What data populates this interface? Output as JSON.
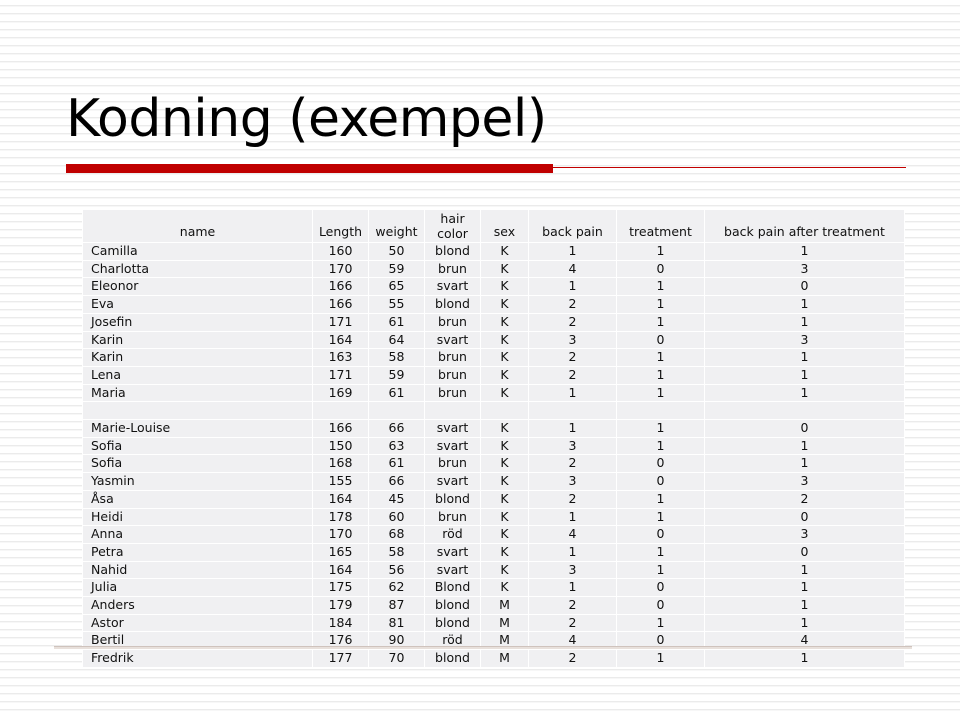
{
  "slide": {
    "title": "Kodning (exempel)",
    "accent_color": "#c00000",
    "rule_color": "#cfc3bd"
  },
  "table": {
    "columns": [
      {
        "key": "name",
        "label": "name",
        "line1": "",
        "line2": "name"
      },
      {
        "key": "length",
        "label": "Length",
        "line1": "",
        "line2": "Length"
      },
      {
        "key": "weight",
        "label": "weight",
        "line1": "",
        "line2": "weight"
      },
      {
        "key": "hair_color",
        "label": "hair color",
        "line1": "hair",
        "line2": "color"
      },
      {
        "key": "sex",
        "label": "sex",
        "line1": "",
        "line2": "sex"
      },
      {
        "key": "back_pain",
        "label": "back pain",
        "line1": "",
        "line2": "back pain"
      },
      {
        "key": "treatment",
        "label": "treatment",
        "line1": "",
        "line2": "treatment"
      },
      {
        "key": "back_pain_after",
        "label": "back pain after treatment",
        "line1": "",
        "line2": "back pain after treatment"
      }
    ],
    "rows": [
      {
        "name": "Camilla",
        "length": "160",
        "weight": "50",
        "hair_color": "blond",
        "sex": "K",
        "back_pain": "1",
        "treatment": "1",
        "back_pain_after": "1"
      },
      {
        "name": "Charlotta",
        "length": "170",
        "weight": "59",
        "hair_color": "brun",
        "sex": "K",
        "back_pain": "4",
        "treatment": "0",
        "back_pain_after": "3"
      },
      {
        "name": "Eleonor",
        "length": "166",
        "weight": "65",
        "hair_color": "svart",
        "sex": "K",
        "back_pain": "1",
        "treatment": "1",
        "back_pain_after": "0"
      },
      {
        "name": "Eva",
        "length": "166",
        "weight": "55",
        "hair_color": "blond",
        "sex": "K",
        "back_pain": "2",
        "treatment": "1",
        "back_pain_after": "1"
      },
      {
        "name": "Josefin",
        "length": "171",
        "weight": "61",
        "hair_color": "brun",
        "sex": "K",
        "back_pain": "2",
        "treatment": "1",
        "back_pain_after": "1"
      },
      {
        "name": "Karin",
        "length": "164",
        "weight": "64",
        "hair_color": "svart",
        "sex": "K",
        "back_pain": "3",
        "treatment": "0",
        "back_pain_after": "3"
      },
      {
        "name": "Karin",
        "length": "163",
        "weight": "58",
        "hair_color": "brun",
        "sex": "K",
        "back_pain": "2",
        "treatment": "1",
        "back_pain_after": "1"
      },
      {
        "name": "Lena",
        "length": "171",
        "weight": "59",
        "hair_color": "brun",
        "sex": "K",
        "back_pain": "2",
        "treatment": "1",
        "back_pain_after": "1"
      },
      {
        "name": "Maria",
        "length": "169",
        "weight": "61",
        "hair_color": "brun",
        "sex": "K",
        "back_pain": "1",
        "treatment": "1",
        "back_pain_after": "1"
      },
      {
        "name": "",
        "length": "",
        "weight": "",
        "hair_color": "",
        "sex": "",
        "back_pain": "",
        "treatment": "",
        "back_pain_after": ""
      },
      {
        "name": "Marie-Louise",
        "length": "166",
        "weight": "66",
        "hair_color": "svart",
        "sex": "K",
        "back_pain": "1",
        "treatment": "1",
        "back_pain_after": "0"
      },
      {
        "name": "Sofia",
        "length": "150",
        "weight": "63",
        "hair_color": "svart",
        "sex": "K",
        "back_pain": "3",
        "treatment": "1",
        "back_pain_after": "1"
      },
      {
        "name": "Sofia",
        "length": "168",
        "weight": "61",
        "hair_color": "brun",
        "sex": "K",
        "back_pain": "2",
        "treatment": "0",
        "back_pain_after": "1"
      },
      {
        "name": "Yasmin",
        "length": "155",
        "weight": "66",
        "hair_color": "svart",
        "sex": "K",
        "back_pain": "3",
        "treatment": "0",
        "back_pain_after": "3"
      },
      {
        "name": "Åsa",
        "length": "164",
        "weight": "45",
        "hair_color": "blond",
        "sex": "K",
        "back_pain": "2",
        "treatment": "1",
        "back_pain_after": "2"
      },
      {
        "name": "Heidi",
        "length": "178",
        "weight": "60",
        "hair_color": "brun",
        "sex": "K",
        "back_pain": "1",
        "treatment": "1",
        "back_pain_after": "0"
      },
      {
        "name": "Anna",
        "length": "170",
        "weight": "68",
        "hair_color": "röd",
        "sex": "K",
        "back_pain": "4",
        "treatment": "0",
        "back_pain_after": "3"
      },
      {
        "name": "Petra",
        "length": "165",
        "weight": "58",
        "hair_color": "svart",
        "sex": "K",
        "back_pain": "1",
        "treatment": "1",
        "back_pain_after": "0"
      },
      {
        "name": "Nahid",
        "length": "164",
        "weight": "56",
        "hair_color": "svart",
        "sex": "K",
        "back_pain": "3",
        "treatment": "1",
        "back_pain_after": "1"
      },
      {
        "name": "Julia",
        "length": "175",
        "weight": "62",
        "hair_color": "Blond",
        "sex": "K",
        "back_pain": "1",
        "treatment": "0",
        "back_pain_after": "1"
      },
      {
        "name": "Anders",
        "length": "179",
        "weight": "87",
        "hair_color": "blond",
        "sex": "M",
        "back_pain": "2",
        "treatment": "0",
        "back_pain_after": "1"
      },
      {
        "name": "Astor",
        "length": "184",
        "weight": "81",
        "hair_color": "blond",
        "sex": "M",
        "back_pain": "2",
        "treatment": "1",
        "back_pain_after": "1"
      },
      {
        "name": "Bertil",
        "length": "176",
        "weight": "90",
        "hair_color": "röd",
        "sex": "M",
        "back_pain": "4",
        "treatment": "0",
        "back_pain_after": "4"
      },
      {
        "name": "Fredrik",
        "length": "177",
        "weight": "70",
        "hair_color": "blond",
        "sex": "M",
        "back_pain": "2",
        "treatment": "1",
        "back_pain_after": "1"
      }
    ]
  }
}
